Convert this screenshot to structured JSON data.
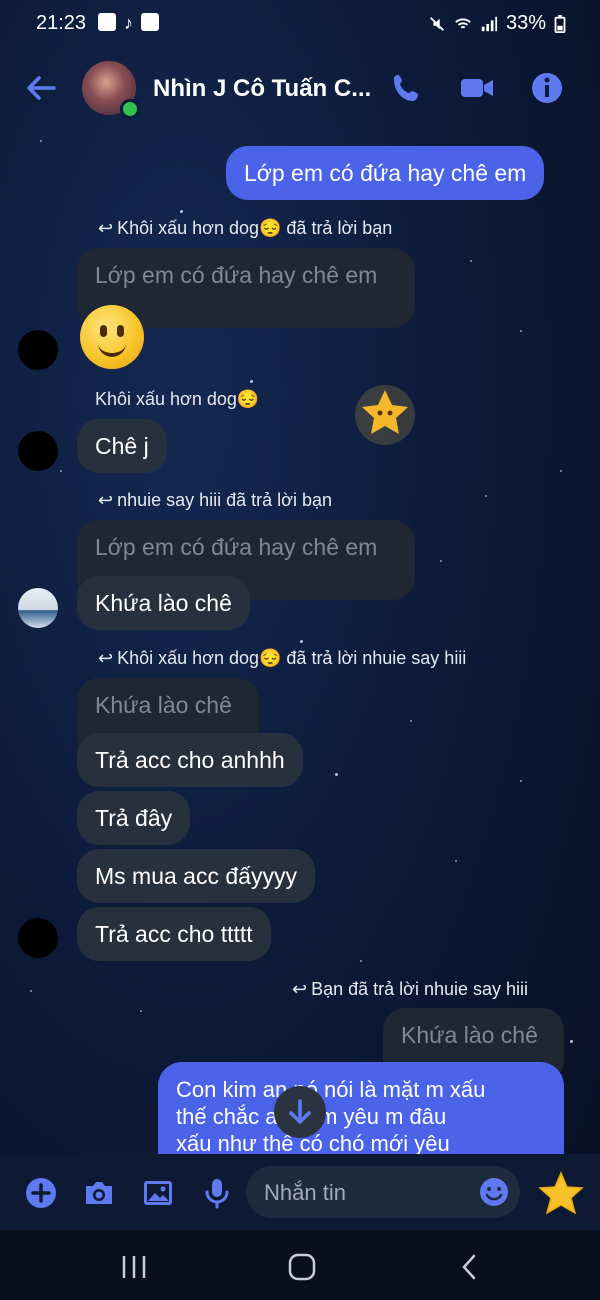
{
  "status_bar": {
    "time": "21:23",
    "battery": "33%"
  },
  "header": {
    "contact_name": "Nhìn J Cô Tuấn C..."
  },
  "messages": {
    "out1": "Lớp em có đứa hay chê em",
    "reply1_note": "Khôi xấu hơn dog😔 đã trả lời bạn",
    "reply1_quote": "Lớp em có đứa hay chê em",
    "sender_khoi": "Khôi xấu hơn dog😔",
    "in_che_j": "Chê j",
    "reply2_note": "nhuie say hiii đã trả lời bạn",
    "reply2_quote": "Lớp em có đứa hay chê em",
    "in_khua": "Khứa lào chê",
    "reply3_note": "Khôi xấu hơn dog😔 đã trả lời nhuie say hiii",
    "reply3_quote": "Khứa lào chê",
    "in_tra_acc": "Trả acc cho anhhh",
    "in_tra_day": "Trả đây",
    "in_ms_mua": "Ms mua acc đấyyyy",
    "in_tra_acc2": "Trả acc cho ttttt",
    "reply4_note": "Bạn đã trả lời nhuie say hiii",
    "reply4_quote": "Khứa lào chê",
    "long_line1": "Con kim an nó nói là mặt m xấu",
    "long_line2": "thế chắc      ai thèm yêu m đâu",
    "long_line3": "xấu như thế có chó mới yêu"
  },
  "input": {
    "placeholder": "Nhắn tin"
  },
  "colors": {
    "accent": "#4a63e8",
    "incoming": "#27303d",
    "background": "#0d1b3a"
  }
}
